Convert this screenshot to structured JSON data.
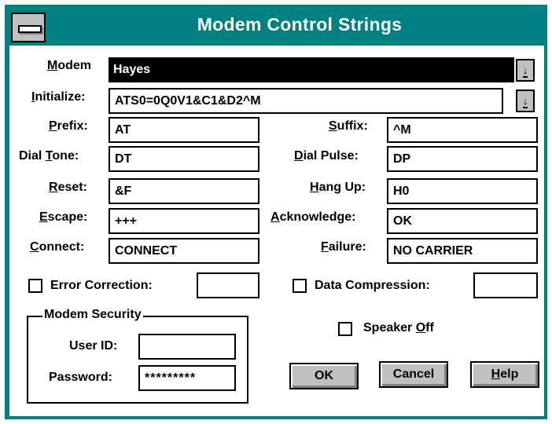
{
  "window": {
    "title": "Modem Control Strings"
  },
  "modem": {
    "label": "Modem",
    "value": "Hayes"
  },
  "initialize": {
    "label": "Initialize:",
    "value": "ATS0=0Q0V1&C1&D2^M"
  },
  "prefix": {
    "label": "Prefix:",
    "value": "AT"
  },
  "suffix": {
    "label": "Suffix:",
    "value": "^M"
  },
  "dial_tone": {
    "label": "Dial Tone:",
    "value": "DT"
  },
  "dial_pulse": {
    "label": "Dial Pulse:",
    "value": "DP"
  },
  "reset": {
    "label": "Reset:",
    "value": "&F"
  },
  "hang_up": {
    "label": "Hang Up:",
    "value": "H0"
  },
  "escape": {
    "label": "Escape:",
    "value": "+++"
  },
  "acknowledge": {
    "label": "Acknowledge:",
    "value": "OK"
  },
  "connect": {
    "label": "Connect:",
    "value": "CONNECT"
  },
  "failure": {
    "label": "Failure:",
    "value": "NO CARRIER"
  },
  "error_correction": {
    "label": "Error Correction:",
    "value": "",
    "checked": false
  },
  "data_compression": {
    "label": "Data Compression:",
    "value": "",
    "checked": false
  },
  "security": {
    "title": "Modem Security",
    "user_id_label": "User ID:",
    "user_id": "",
    "password_label": "Password:",
    "password": "*********"
  },
  "speaker_off": {
    "label": "Speaker Off",
    "checked": false
  },
  "buttons": {
    "ok": "OK",
    "cancel": "Cancel",
    "help": "Help"
  },
  "icons": {
    "system_menu": "system-menu-icon",
    "dropdown": "dropdown-arrow-icon"
  },
  "colors": {
    "title_bar": "#008080",
    "button_face": "#c0c0c0",
    "selection": "#000000"
  }
}
